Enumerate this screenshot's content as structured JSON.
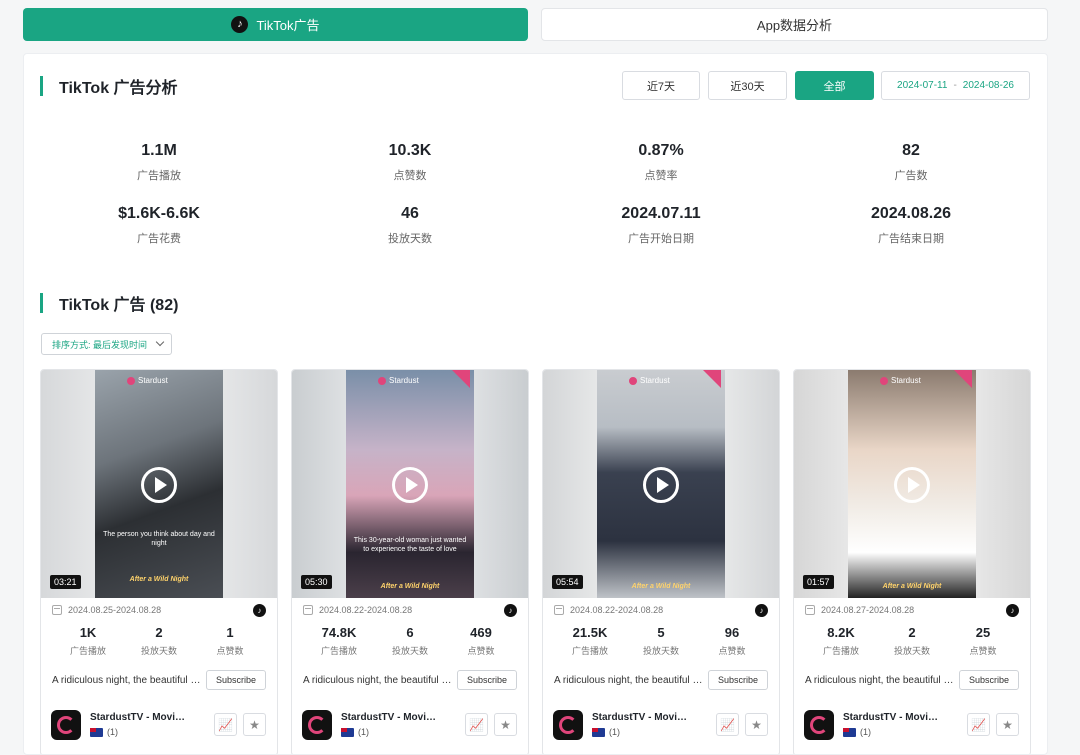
{
  "tabs": [
    {
      "label": "TikTok广告",
      "active": true
    },
    {
      "label": "App数据分析",
      "active": false
    }
  ],
  "section1": {
    "title": "TikTok 广告分析"
  },
  "range_buttons": [
    {
      "label": "近7天",
      "active": false
    },
    {
      "label": "近30天",
      "active": false
    },
    {
      "label": "全部",
      "active": true
    }
  ],
  "date_range": {
    "start": "2024-07-11",
    "sep": "-",
    "end": "2024-08-26"
  },
  "stats": [
    {
      "value": "1.1M",
      "label": "广告播放"
    },
    {
      "value": "10.3K",
      "label": "点赞数"
    },
    {
      "value": "0.87%",
      "label": "点赞率"
    },
    {
      "value": "82",
      "label": "广告数"
    },
    {
      "value": "$1.6K-6.6K",
      "label": "广告花费"
    },
    {
      "value": "46",
      "label": "投放天数"
    },
    {
      "value": "2024.07.11",
      "label": "广告开始日期"
    },
    {
      "value": "2024.08.26",
      "label": "广告结束日期"
    }
  ],
  "section2": {
    "title": "TikTok 广告 (82)"
  },
  "sort": {
    "label": "排序方式: 最后发现时间"
  },
  "cards": [
    {
      "duration": "03:21",
      "brand": "Stardust",
      "caption": "The person you think about day and night",
      "subtitle": "After a Wild Night",
      "date": "2024.08.25-2024.08.28",
      "plays": "1K",
      "plays_label": "广告播放",
      "days": "2",
      "days_label": "投放天数",
      "likes": "1",
      "likes_label": "点赞数",
      "desc": "A ridiculous night, the beautiful CEO...",
      "subscribe": "Subscribe",
      "app_name": "StardustTV - Movies & TV",
      "app_count": "(1)"
    },
    {
      "duration": "05:30",
      "brand": "Stardust",
      "caption": "This 30-year-old woman just wanted to experience the taste of love",
      "subtitle": "After a Wild Night",
      "date": "2024.08.22-2024.08.28",
      "plays": "74.8K",
      "plays_label": "广告播放",
      "days": "6",
      "days_label": "投放天数",
      "likes": "469",
      "likes_label": "点赞数",
      "desc": "A ridiculous night, the beautiful CEO...",
      "subscribe": "Subscribe",
      "app_name": "StardustTV - Movies & TV",
      "app_count": "(1)"
    },
    {
      "duration": "05:54",
      "brand": "Stardust",
      "caption": "",
      "subtitle": "After a Wild Night",
      "date": "2024.08.22-2024.08.28",
      "plays": "21.5K",
      "plays_label": "广告播放",
      "days": "5",
      "days_label": "投放天数",
      "likes": "96",
      "likes_label": "点赞数",
      "desc": "A ridiculous night, the beautiful CEO...",
      "subscribe": "Subscribe",
      "app_name": "StardustTV - Movies & TV",
      "app_count": "(1)"
    },
    {
      "duration": "01:57",
      "brand": "Stardust",
      "caption": "",
      "subtitle": "After a Wild Night",
      "date": "2024.08.27-2024.08.28",
      "plays": "8.2K",
      "plays_label": "广告播放",
      "days": "2",
      "days_label": "投放天数",
      "likes": "25",
      "likes_label": "点赞数",
      "desc": "A ridiculous night, the beautiful CEO...",
      "subscribe": "Subscribe",
      "app_name": "StardustTV - Movies & TV",
      "app_count": "(1)"
    }
  ],
  "colors": {
    "accent": "#1aa583",
    "brand_pink": "#e0457b"
  },
  "icons": [
    "tiktok-icon",
    "calendar-icon",
    "play-icon",
    "chart-icon",
    "star-icon",
    "chevron-down-icon",
    "au-flag-icon"
  ]
}
